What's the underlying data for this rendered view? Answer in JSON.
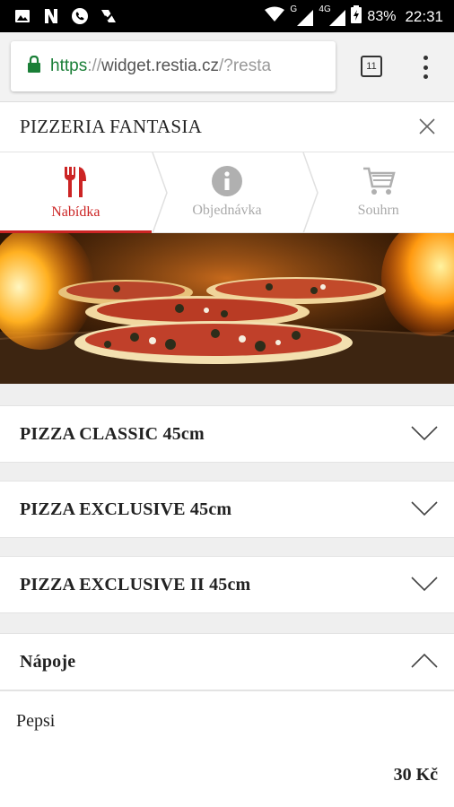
{
  "status_bar": {
    "left_icons": [
      "image-icon",
      "n-notification-icon",
      "phone-icon",
      "check-notification-icon"
    ],
    "network_g": "G",
    "network_4g": "4G",
    "battery": "83%",
    "time": "22:31"
  },
  "browser": {
    "url_scheme": "https",
    "url_sep": "://",
    "url_host": "widget.restia.cz",
    "url_rest": "/?resta",
    "tab_count": "11"
  },
  "header": {
    "title": "PIZZERIA FANTASIA"
  },
  "steps": [
    {
      "label": "Nabídka",
      "icon": "cutlery-icon",
      "active": true
    },
    {
      "label": "Objednávka",
      "icon": "info-icon",
      "active": false
    },
    {
      "label": "Souhrn",
      "icon": "cart-icon",
      "active": false
    }
  ],
  "categories": [
    {
      "name": "PIZZA CLASSIC 45cm",
      "expanded": false
    },
    {
      "name": "PIZZA EXCLUSIVE 45cm",
      "expanded": false
    },
    {
      "name": "PIZZA EXCLUSIVE II 45cm",
      "expanded": false
    },
    {
      "name": "Nápoje",
      "expanded": true
    }
  ],
  "items": [
    {
      "name": "Pepsi",
      "price": "30 Kč"
    }
  ],
  "colors": {
    "accent": "#cc2424",
    "inactive": "#aaaaaa",
    "url_green": "#1a7f37"
  }
}
